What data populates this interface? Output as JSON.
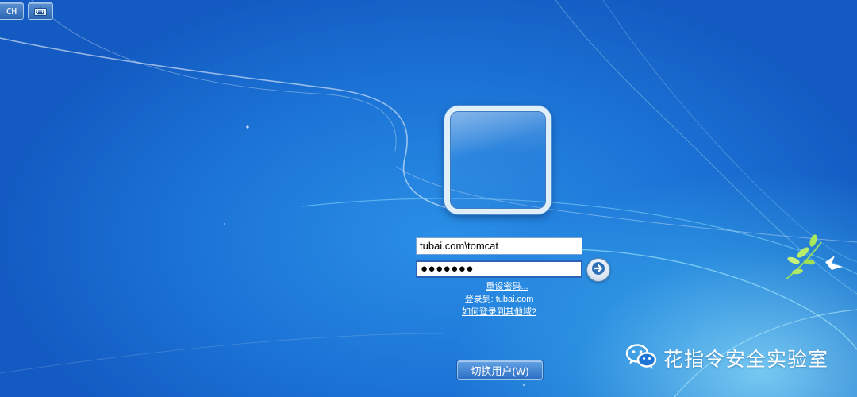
{
  "toolbar": {
    "language_label": "CH",
    "keyboard_icon": "keyboard-icon"
  },
  "login": {
    "username_value": "tubai.com\\tomcat",
    "password_mask": "●●●●●●●",
    "submit_icon": "arrow-right-icon",
    "reset_password_label": "重设密码...",
    "logon_to_label": "登录到: tubai.com",
    "other_domain_label": "如何登录到其他域?"
  },
  "footer": {
    "switch_user_label": "切换用户(W)"
  },
  "watermark": {
    "icon": "wechat-icon",
    "text": "花指令安全实验室"
  },
  "colors": {
    "background": "#1c74d6",
    "field_border": "#2b62b8",
    "text": "#ffffff"
  }
}
